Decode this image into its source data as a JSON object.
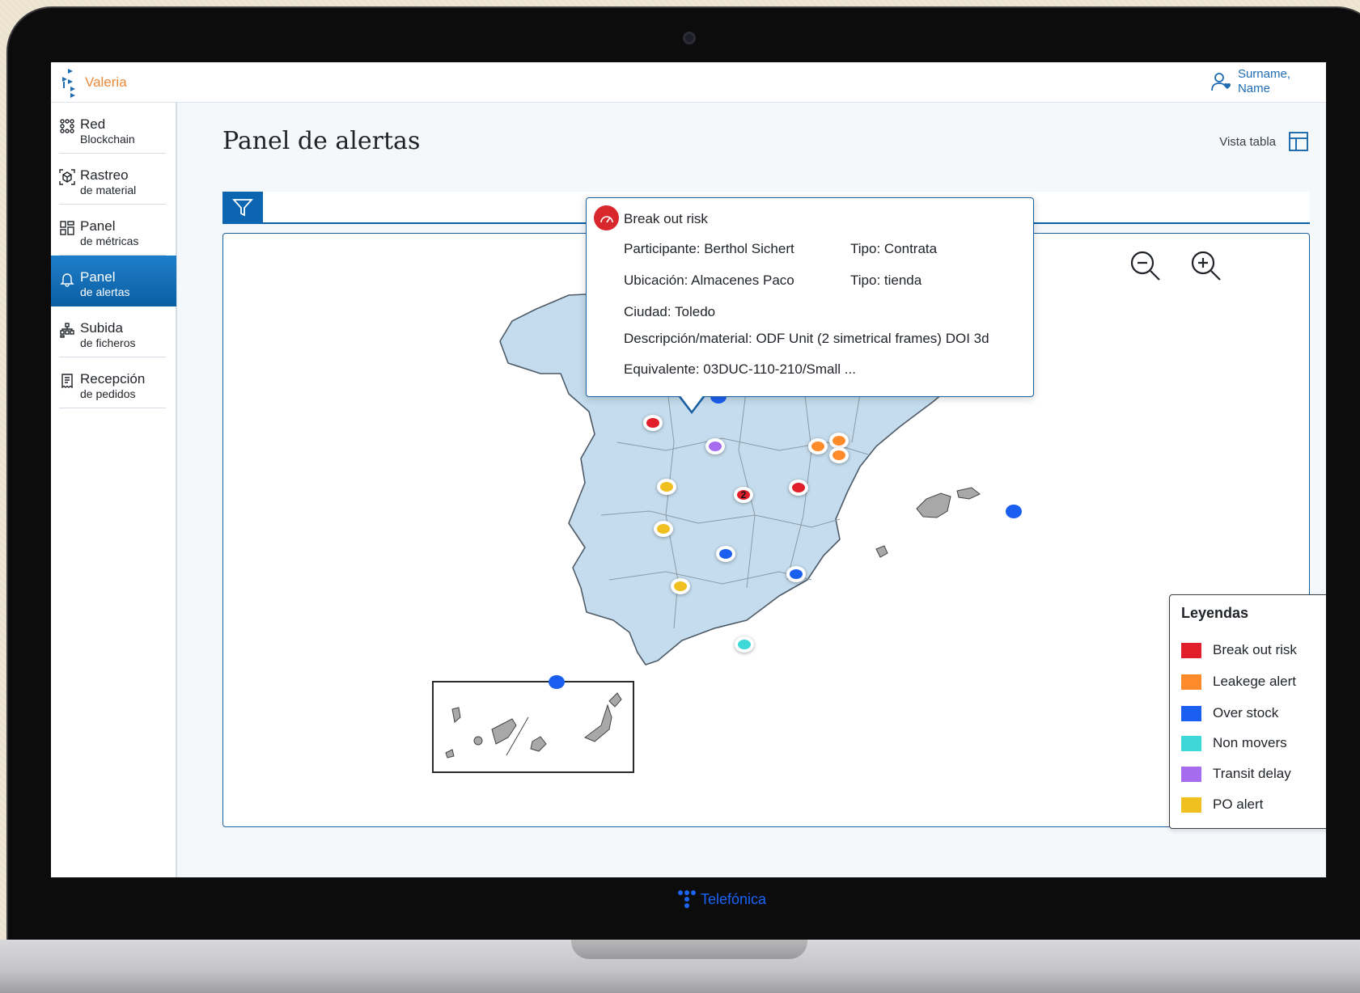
{
  "app": {
    "name": "Valeria"
  },
  "user": {
    "line1": "Surname,",
    "line2": "Name"
  },
  "sidebar": {
    "items": [
      {
        "l1": "Red",
        "l2": "Blockchain",
        "icon": "network-icon",
        "active": false
      },
      {
        "l1": "Rastreo",
        "l2": "de material",
        "icon": "cube-scan-icon",
        "active": false
      },
      {
        "l1": "Panel",
        "l2": "de métricas",
        "icon": "dashboard-icon",
        "active": false
      },
      {
        "l1": "Panel",
        "l2": "de alertas",
        "icon": "bell-icon",
        "active": true
      },
      {
        "l1": "Subida",
        "l2": "de ficheros",
        "icon": "upload-files-icon",
        "active": false
      },
      {
        "l1": "Recepción",
        "l2": "de pedidos",
        "icon": "receipt-icon",
        "active": false
      }
    ]
  },
  "page": {
    "title": "Panel de alertas",
    "view_toggle_label": "Vista tabla"
  },
  "tooltip": {
    "title": "Break out risk",
    "participante": "Participante: Berthol Sichert",
    "tipo1": "Tipo: Contrata",
    "ubicacion": "Ubicación: Almacenes Paco",
    "tipo2": "Tipo: tienda",
    "ciudad": "Ciudad: Toledo",
    "descripcion": "Descripción/material: ODF Unit (2 simetrical frames) DOI 3d",
    "equivalente": "Equivalente: 03DUC-110-210/Small ..."
  },
  "legend": {
    "title": "Leyendas",
    "items": [
      {
        "label": "Break out risk",
        "color": "#e01f2b"
      },
      {
        "label": "Leakege alert",
        "color": "#ff8a2a"
      },
      {
        "label": "Over stock",
        "color": "#1a5ff0"
      },
      {
        "label": "Non movers",
        "color": "#3ed8d8"
      },
      {
        "label": "Transit delay",
        "color": "#a56cf0"
      },
      {
        "label": "PO alert",
        "color": "#f0c020"
      }
    ]
  },
  "markers": [
    {
      "type": "Break out risk",
      "count": "2"
    }
  ],
  "footer": {
    "brand": "Telefónica"
  }
}
